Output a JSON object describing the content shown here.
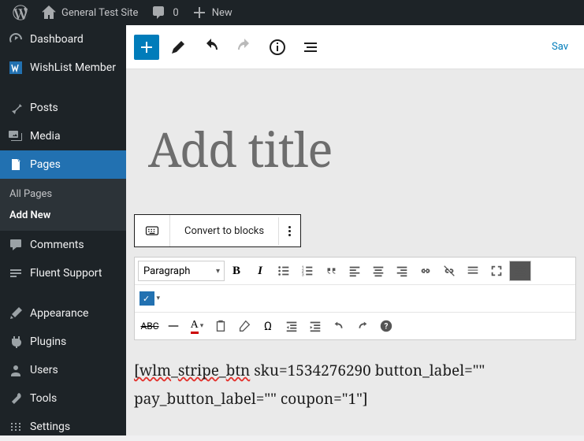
{
  "adminbar": {
    "site_name": "General Test Site",
    "comment_count": "0",
    "new_label": "New"
  },
  "sidebar": {
    "items": [
      {
        "label": "Dashboard"
      },
      {
        "label": "WishList Member"
      },
      {
        "label": "Posts"
      },
      {
        "label": "Media"
      },
      {
        "label": "Pages"
      },
      {
        "label": "Comments"
      },
      {
        "label": "Fluent Support"
      },
      {
        "label": "Appearance"
      },
      {
        "label": "Plugins"
      },
      {
        "label": "Users"
      },
      {
        "label": "Tools"
      },
      {
        "label": "Settings"
      }
    ],
    "submenu": {
      "all": "All Pages",
      "add": "Add New"
    }
  },
  "editor": {
    "save_draft": "Sav",
    "title_placeholder": "Add title",
    "convert_label": "Convert to blocks",
    "format_select": "Paragraph",
    "shortcode_line1_a": "[wlm",
    "shortcode_line1_b": "stripe",
    "shortcode_line1_c": "btn",
    "shortcode_line1_d": " sku=1534276290 button_label=\"\"",
    "shortcode_line2": "pay_button_label=\"\" coupon=\"1\"]"
  }
}
